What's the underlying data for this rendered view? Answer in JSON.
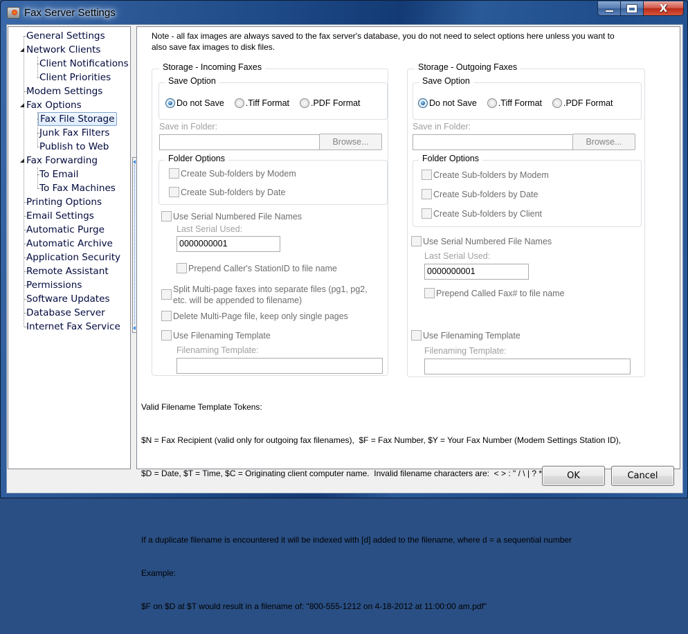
{
  "window": {
    "title": "Fax Server Settings",
    "caption_buttons": {
      "minimize": "minimize-icon",
      "maximize": "maximize-icon",
      "close": "close-icon"
    },
    "close_glyph": "X"
  },
  "tree": {
    "items": [
      {
        "label": "General Settings",
        "level": 0
      },
      {
        "label": "Network Clients",
        "level": 0,
        "expanded": true
      },
      {
        "label": "Client Notifications",
        "level": 1
      },
      {
        "label": "Client Priorities",
        "level": 1
      },
      {
        "label": "Modem Settings",
        "level": 0
      },
      {
        "label": "Fax Options",
        "level": 0,
        "expanded": true
      },
      {
        "label": "Fax File Storage",
        "level": 1,
        "selected": true
      },
      {
        "label": "Junk Fax Filters",
        "level": 1
      },
      {
        "label": "Publish to Web",
        "level": 1
      },
      {
        "label": "Fax Forwarding",
        "level": 0,
        "expanded": true
      },
      {
        "label": "To Email",
        "level": 1
      },
      {
        "label": "To Fax Machines",
        "level": 1
      },
      {
        "label": "Printing Options",
        "level": 0
      },
      {
        "label": "Email Settings",
        "level": 0
      },
      {
        "label": "Automatic Purge",
        "level": 0
      },
      {
        "label": "Automatic Archive",
        "level": 0
      },
      {
        "label": "Application Security",
        "level": 0
      },
      {
        "label": "Remote Assistant",
        "level": 0
      },
      {
        "label": "Permissions",
        "level": 0
      },
      {
        "label": "Software Updates",
        "level": 0
      },
      {
        "label": "Database Server",
        "level": 0
      },
      {
        "label": "Internet Fax Service",
        "level": 0
      }
    ]
  },
  "note": {
    "line1": "Note - all fax images are always saved to the fax server's database, you do not need to select options here unless you want to",
    "line2": "also save fax images to disk files."
  },
  "incoming": {
    "title": "Storage - Incoming Faxes",
    "save_option_title": "Save Option",
    "radios": [
      {
        "label": "Do not Save",
        "checked": true
      },
      {
        "label": ".Tiff Format",
        "checked": false
      },
      {
        "label": ".PDF Format",
        "checked": false
      }
    ],
    "save_in_folder_label": "Save in Folder:",
    "save_in_folder_value": "",
    "browse_label": "Browse...",
    "folder_options_title": "Folder Options",
    "folder_options": [
      {
        "label": "Create Sub-folders by Modem",
        "checked": false
      },
      {
        "label": "Create Sub-folders by Date",
        "checked": false
      }
    ],
    "serial_label": "Use Serial Numbered File Names",
    "last_serial_label": "Last Serial Used:",
    "last_serial_value": "0000000001",
    "prepend_label": "Prepend Caller's StationID to file name",
    "split_label_1": "Split Multi-page faxes into separate files (pg1, pg2,",
    "split_label_2": "etc. will be appended to filename)",
    "delete_label": "Delete Multi-Page file, keep only single pages",
    "template_checkbox_label": "Use Filenaming Template",
    "template_label": "Filenaming Template:",
    "template_value": ""
  },
  "outgoing": {
    "title": "Storage - Outgoing Faxes",
    "save_option_title": "Save Option",
    "radios": [
      {
        "label": "Do not Save",
        "checked": true
      },
      {
        "label": ".Tiff Format",
        "checked": false
      },
      {
        "label": ".PDF Format",
        "checked": false
      }
    ],
    "save_in_folder_label": "Save in Folder:",
    "save_in_folder_value": "",
    "browse_label": "Browse...",
    "folder_options_title": "Folder Options",
    "folder_options": [
      {
        "label": "Create Sub-folders by Modem",
        "checked": false
      },
      {
        "label": "Create Sub-folders by Date",
        "checked": false
      },
      {
        "label": "Create Sub-folders by Client",
        "checked": false
      }
    ],
    "serial_label": "Use Serial Numbered File Names",
    "last_serial_label": "Last Serial Used:",
    "last_serial_value": "0000000001",
    "prepend_label": "Prepend Called Fax# to file name",
    "template_checkbox_label": "Use Filenaming Template",
    "template_label": "Filenaming Template:",
    "template_value": ""
  },
  "tokens_help": {
    "lines": [
      "Valid Filename Template Tokens:",
      "$N = Fax Recipient (valid only for outgoing fax filenames),  $F = Fax Number, $Y = Your Fax Number (Modem Settings Station ID),",
      "$D = Date, $T = Time, $C = Originating client computer name.  Invalid filename characters are:  < > : \" / \\ | ? *",
      "",
      "If a duplicate filename is encountered it will be indexed with [d] added to the filename, where d = a sequential number",
      "Example:",
      "$F on $D at $T would result in a filename of: \"800-555-1212 on 4-18-2012 at 11:00:00 am.pdf\""
    ]
  },
  "footer": {
    "ok_label": "OK",
    "cancel_label": "Cancel"
  }
}
